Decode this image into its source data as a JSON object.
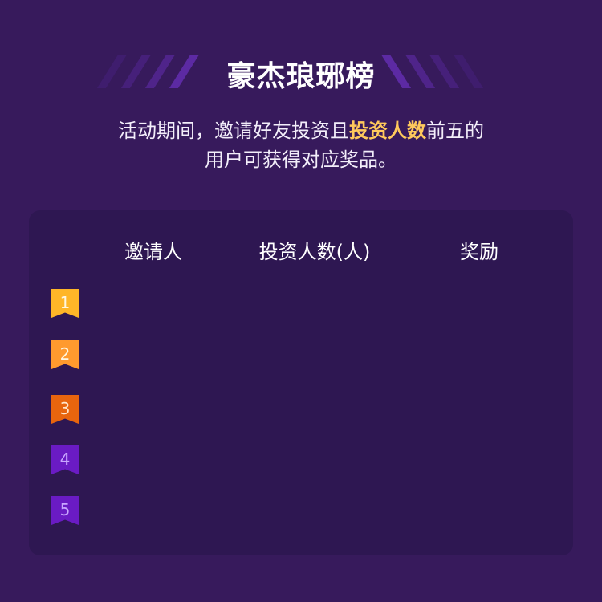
{
  "title": "豪杰琅琊榜",
  "description": {
    "line1_pre": "活动期间，邀请好友投资且",
    "highlight": "投资人数",
    "line1_post": "前五的",
    "line2": "用户可获得对应奖品。"
  },
  "table": {
    "headers": [
      "邀请人",
      "投资人数(人)",
      "奖励"
    ],
    "ranks": [
      {
        "label": "1",
        "color": "#ffb628",
        "text_color": "#fff6e0"
      },
      {
        "label": "2",
        "color": "#ff9a2e",
        "text_color": "#fff6e0"
      },
      {
        "label": "3",
        "color": "#e8650e",
        "text_color": "#ffe6cc"
      },
      {
        "label": "4",
        "color": "#6a1bc4",
        "text_color": "#c9a6ff"
      },
      {
        "label": "5",
        "color": "#6a1bc4",
        "text_color": "#c9a6ff"
      }
    ]
  },
  "colors": {
    "background": "#371a5c",
    "card": "#2e1752",
    "highlight": "#ffc95c",
    "stripe": "#5a2aa0"
  }
}
